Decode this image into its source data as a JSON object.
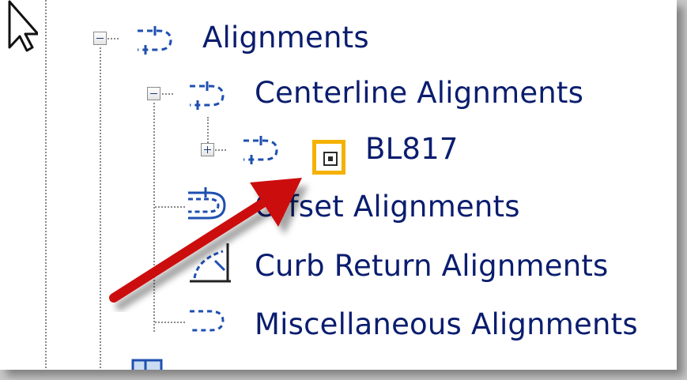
{
  "tree": {
    "alignments": {
      "label": "Alignments",
      "icon": "alignment-icon",
      "expander": "collapse"
    },
    "centerline": {
      "label": "Centerline Alignments",
      "icon": "alignment-icon",
      "expander": "collapse"
    },
    "bl817": {
      "label": "BL817",
      "icon": "alignment-icon",
      "expander": "expand",
      "badge_icon": "reference-badge-icon"
    },
    "offset": {
      "label": "Offset Alignments",
      "icon": "offset-alignment-icon"
    },
    "curb_return": {
      "label": "Curb Return Alignments",
      "icon": "curb-return-alignment-icon"
    },
    "miscellaneous": {
      "label": "Miscellaneous Alignments",
      "icon": "misc-alignment-icon"
    }
  },
  "annotation": {
    "arrow_color": "#cc1111",
    "highlight_color": "#f5b100"
  },
  "cursor": {
    "icon": "mouse-pointer-icon"
  }
}
